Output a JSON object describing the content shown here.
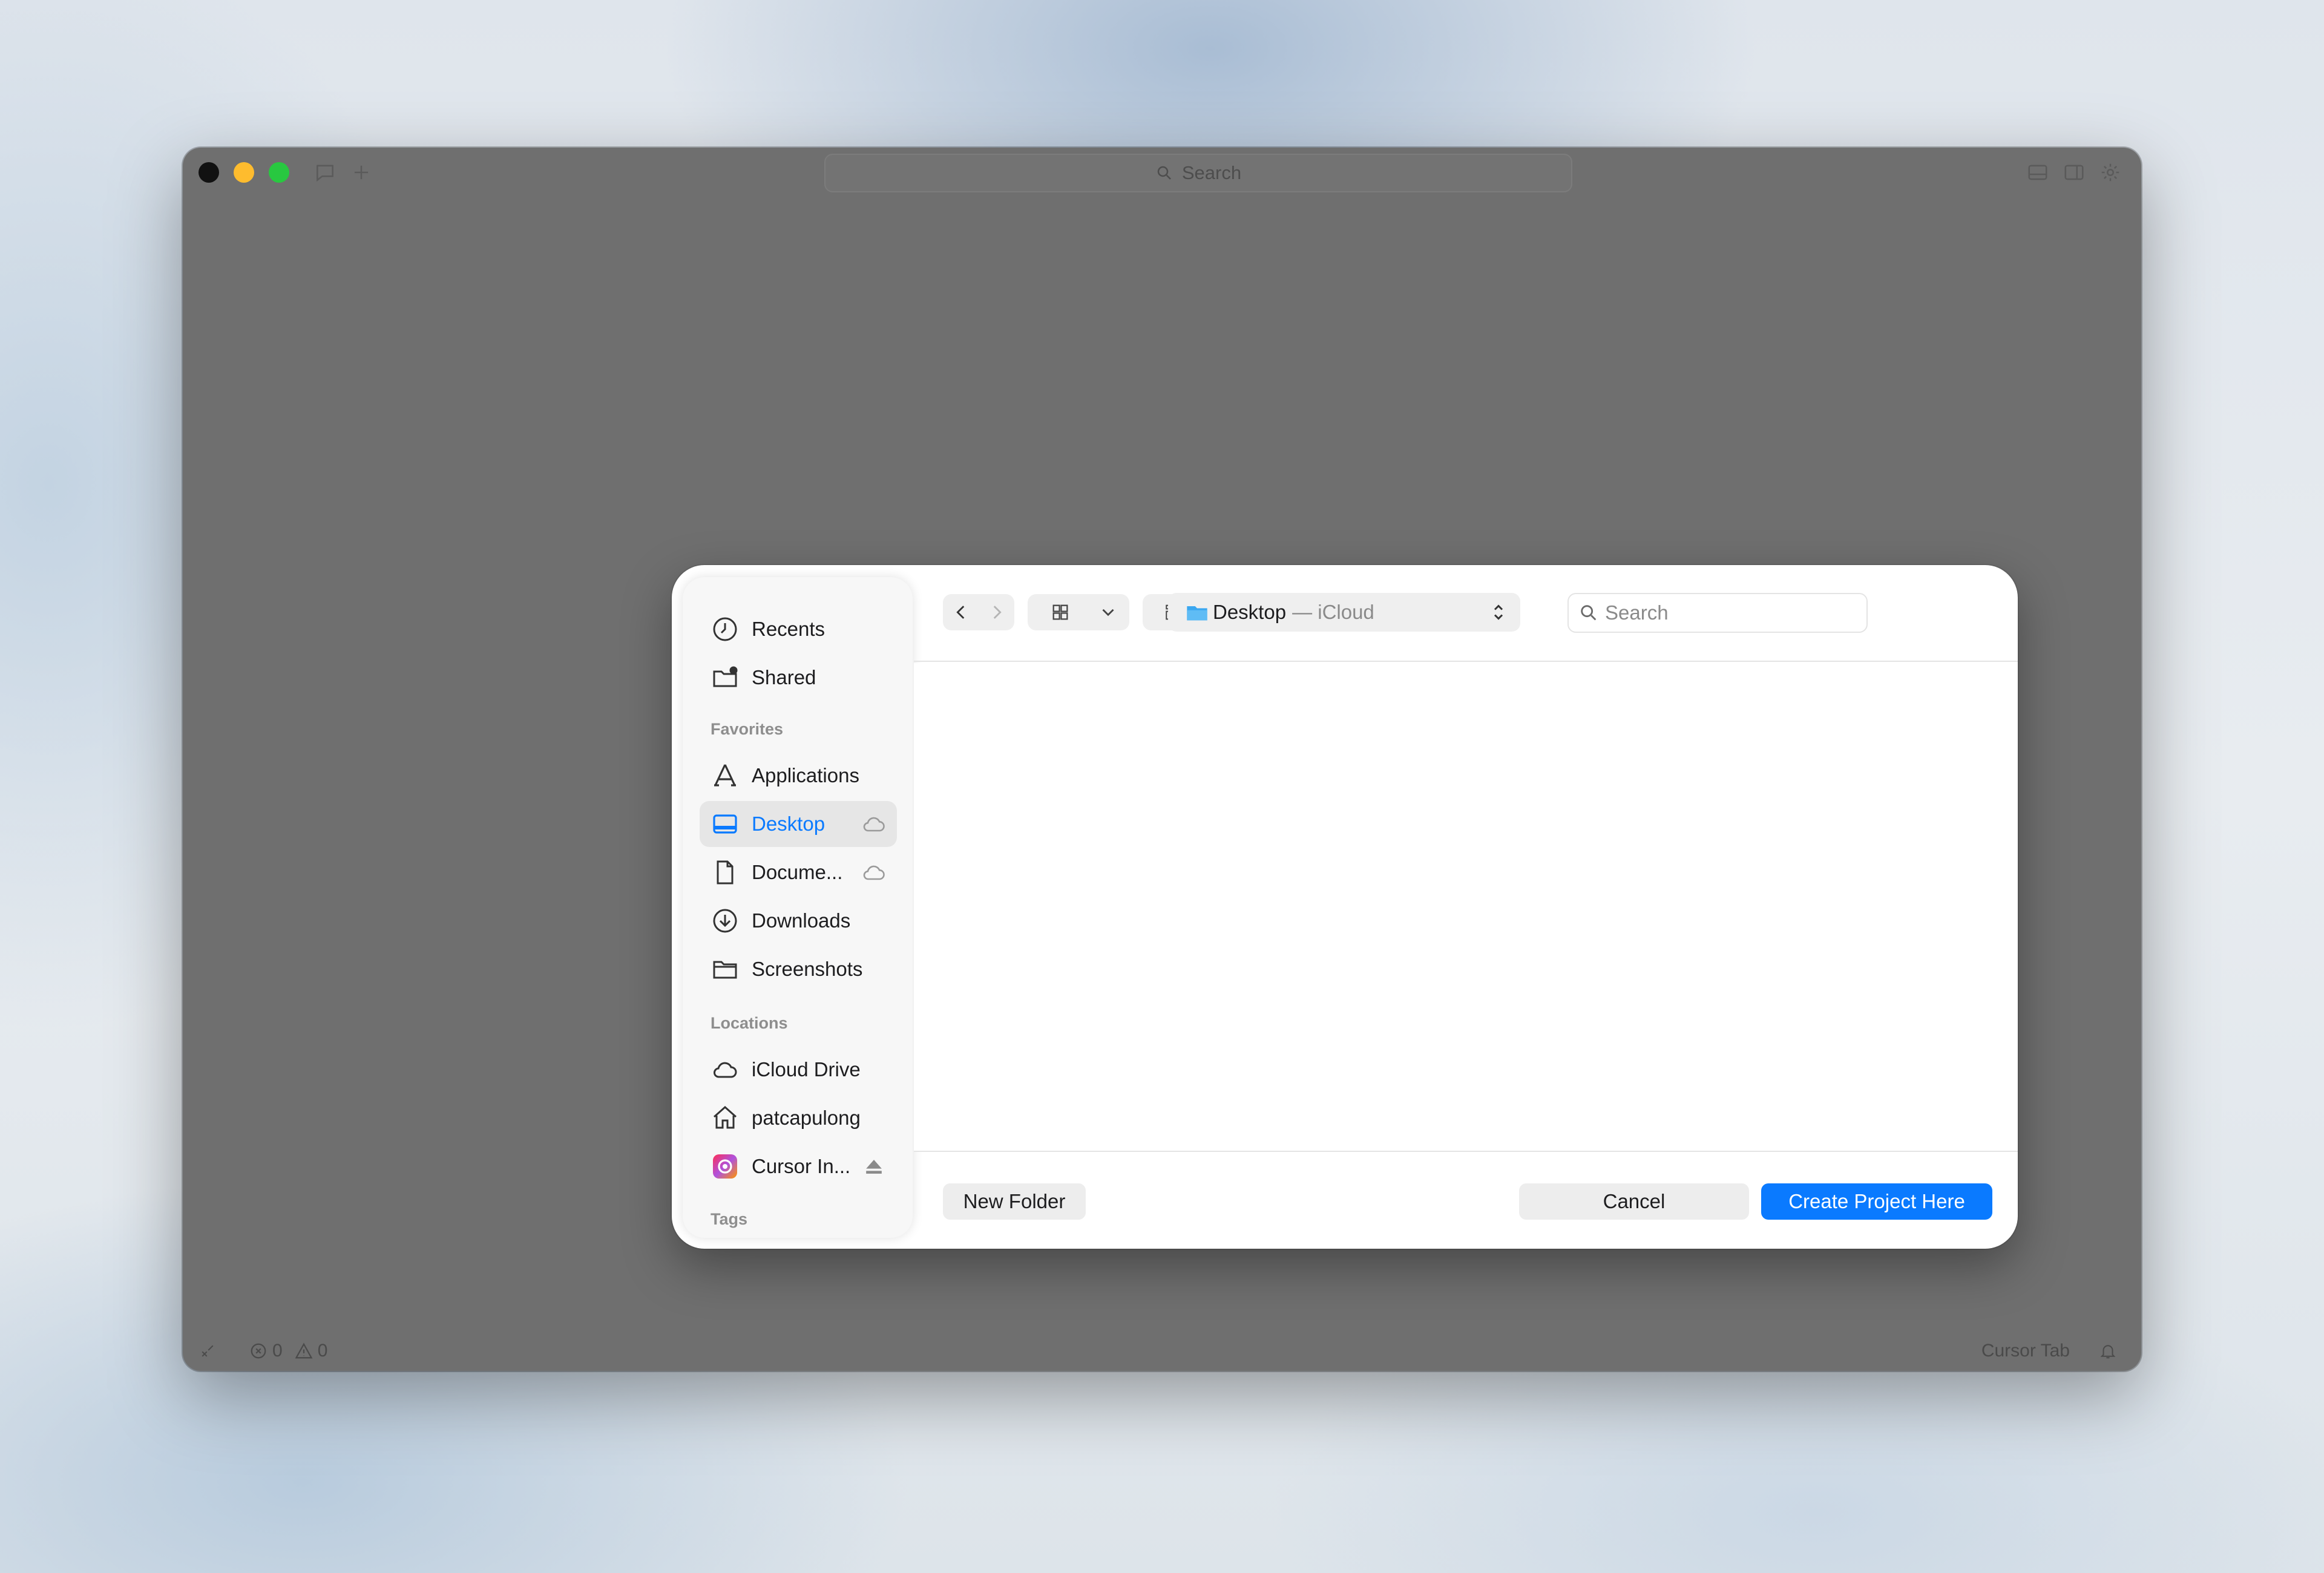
{
  "window": {
    "search_placeholder": "Search",
    "status_errors": "0",
    "status_warnings": "0",
    "status_right_label": "Cursor Tab"
  },
  "sidebar": {
    "top_items": [
      {
        "label": "Recents",
        "icon": "clock-icon"
      },
      {
        "label": "Shared",
        "icon": "shared-folder-icon"
      }
    ],
    "favorites_heading": "Favorites",
    "favorites": [
      {
        "label": "Applications",
        "icon": "applications-icon"
      },
      {
        "label": "Desktop",
        "icon": "desktop-icon",
        "selected": true,
        "trailing": "cloud-icon"
      },
      {
        "label": "Docume...",
        "icon": "document-icon",
        "trailing": "cloud-icon"
      },
      {
        "label": "Downloads",
        "icon": "download-icon"
      },
      {
        "label": "Screenshots",
        "icon": "folder-icon"
      }
    ],
    "locations_heading": "Locations",
    "locations": [
      {
        "label": "iCloud Drive",
        "icon": "cloud-icon"
      },
      {
        "label": "patcapulong",
        "icon": "home-icon"
      },
      {
        "label": "Cursor In...",
        "icon": "app-disk-icon",
        "trailing": "eject-icon"
      }
    ],
    "tags_heading": "Tags"
  },
  "toolbar": {
    "path_name": "Desktop",
    "path_suffix": "— iCloud",
    "search_placeholder": "Search"
  },
  "footer": {
    "new_folder": "New Folder",
    "cancel": "Cancel",
    "create": "Create Project Here"
  },
  "colors": {
    "accent": "#0a7aff",
    "window_bg": "#6f6f6f",
    "dialog_bg": "#ffffff"
  }
}
